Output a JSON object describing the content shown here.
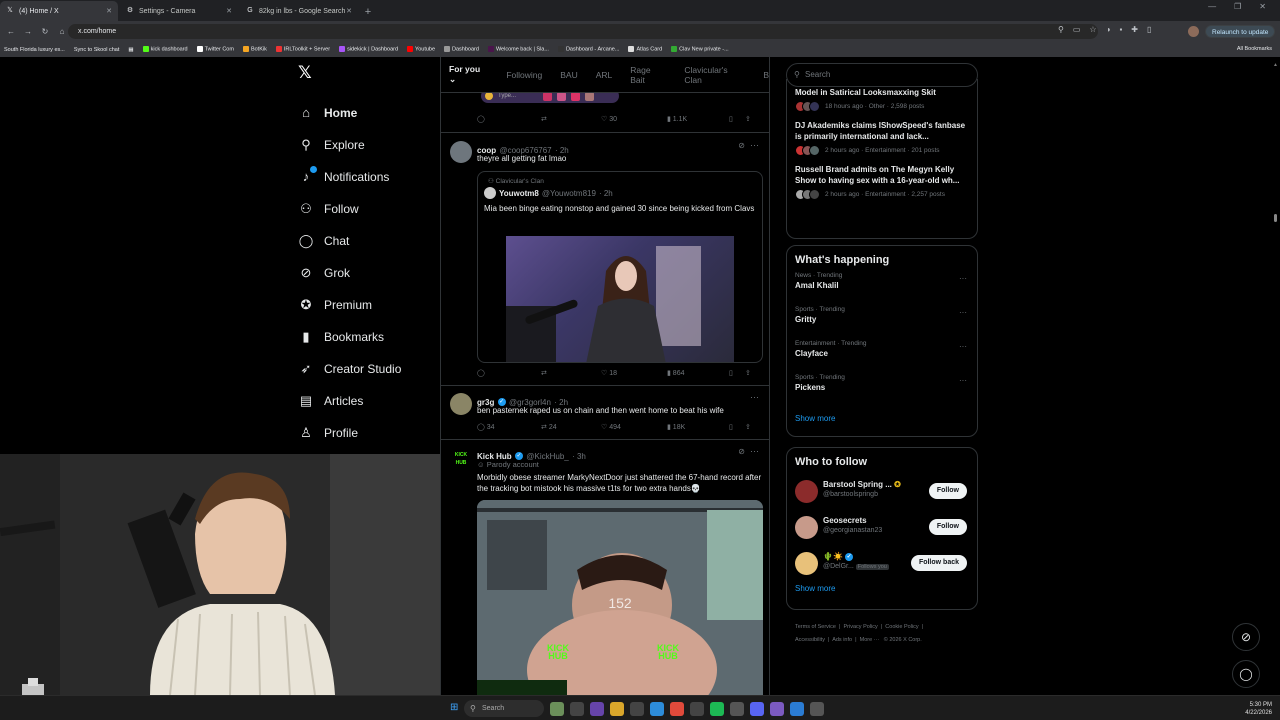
{
  "browser": {
    "tabs": [
      {
        "icon": "x-logo-icon",
        "title": "(4) Home / X",
        "active": true
      },
      {
        "icon": "gear-icon",
        "title": "Settings - Camera",
        "active": false
      },
      {
        "icon": "google-icon",
        "title": "82kg in lbs - Google Search",
        "active": false
      }
    ],
    "url": "x.com/home",
    "relaunch_label": "Relaunch to update",
    "bookmarks": [
      "South Florida luxury es...",
      "Sync to Skool chat",
      "kick dashboard",
      "Twitter Com",
      "BotKik",
      "IRLToolkit + Server",
      "sidekick | Dashboard",
      "Youtube",
      "Dashboard",
      "Welcome back | Sla...",
      "Dashboard - Arcane...",
      "Atlas Card",
      "Clav New private -..."
    ],
    "all_bookmarks": "All Bookmarks"
  },
  "sidebar": {
    "items": [
      {
        "icon": "home-icon",
        "glyph": "⌂",
        "label": "Home"
      },
      {
        "icon": "search-icon",
        "glyph": "⚲",
        "label": "Explore"
      },
      {
        "icon": "bell-icon",
        "glyph": "♪",
        "label": "Notifications"
      },
      {
        "icon": "follow-icon",
        "glyph": "⚇",
        "label": "Follow"
      },
      {
        "icon": "chat-icon",
        "glyph": "◯",
        "label": "Chat"
      },
      {
        "icon": "grok-icon",
        "glyph": "⊘",
        "label": "Grok"
      },
      {
        "icon": "premium-icon",
        "glyph": "✪",
        "label": "Premium"
      },
      {
        "icon": "bookmark-icon",
        "glyph": "▮",
        "label": "Bookmarks"
      },
      {
        "icon": "rocket-icon",
        "glyph": "➶",
        "label": "Creator Studio"
      },
      {
        "icon": "article-icon",
        "glyph": "▤",
        "label": "Articles"
      },
      {
        "icon": "profile-icon",
        "glyph": "♙",
        "label": "Profile"
      }
    ]
  },
  "timeline": {
    "tabs": [
      "For you",
      "Following",
      "BAU",
      "ARL",
      "Rage Bait",
      "Clavicular's Clan",
      "B"
    ],
    "top_post": {
      "type_pill": "Type...",
      "likes": "30",
      "views": "1.1K"
    },
    "post1": {
      "name": "coop",
      "handle": "@coop676767",
      "time": "· 2h",
      "text": "theyre all getting fat lmao",
      "quote": {
        "community": "Clavicular's Clan",
        "name": "Youwotm8",
        "handle": "@Youwotm819",
        "time": "· 2h",
        "text": "Mia been binge eating nonstop and gained 30 since being kicked from Clavs"
      },
      "likes": "18",
      "views": "864"
    },
    "post2": {
      "name": "gr3g",
      "handle": "@gr3gorl4n",
      "time": "· 2h",
      "text": "ben pasternek raped us on chain and then went home to beat his wife",
      "replies": "34",
      "reposts": "24",
      "likes": "494",
      "views": "18K"
    },
    "post3": {
      "name": "Kick Hub",
      "handle": "@KickHub_",
      "time": "· 3h",
      "label": "Parody account",
      "text": "Morbidly obese streamer MarkyNextDoor just shattered the 67-hand record after the tracking bot mistook his massive t1ts for two extra hands💀",
      "video_counter": "152",
      "watermark": "KICK HUB",
      "avatar_text": "KICK HUB"
    }
  },
  "right": {
    "search_placeholder": "Search",
    "news": [
      {
        "title": "Model in Satirical Looksmaxxing Skit",
        "meta": "18 hours ago · Other · 2,598 posts"
      },
      {
        "title": "DJ Akademiks claims IShowSpeed's fanbase is primarily international and lack...",
        "meta": "2 hours ago · Entertainment · 201 posts"
      },
      {
        "title": "Russell Brand admits on The Megyn Kelly Show to having sex with a 16-year-old wh...",
        "meta": "2 hours ago · Entertainment · 2,257 posts"
      }
    ],
    "happening_title": "What's happening",
    "trends": [
      {
        "category": "News · Trending",
        "name": "Amal Khalil"
      },
      {
        "category": "Sports · Trending",
        "name": "Gritty"
      },
      {
        "category": "Entertainment · Trending",
        "name": "Clayface"
      },
      {
        "category": "Sports · Trending",
        "name": "Pickens"
      }
    ],
    "show_more": "Show more",
    "wtf_title": "Who to follow",
    "wtf": [
      {
        "name": "Barstool Spring ...",
        "handle": "@barstoolspringb",
        "button": "Follow",
        "follows_you": ""
      },
      {
        "name": "Geosecrets",
        "handle": "@georgianastan23",
        "button": "Follow",
        "follows_you": ""
      },
      {
        "name": "🌵☀️",
        "handle": "@DelGr...",
        "button": "Follow back",
        "follows_you": "Follows you"
      }
    ],
    "footer": {
      "links": [
        "Terms of Service",
        "Privacy Policy",
        "Cookie Policy",
        "Accessibility",
        "Ads info",
        "More ···"
      ],
      "copyright": "© 2026 X Corp."
    }
  },
  "taskbar": {
    "search_placeholder": "Search",
    "time": "5:30 PM",
    "date": "4/22/2026"
  },
  "colors": {
    "accent": "#1d9bf0",
    "background": "#000000",
    "border": "#2f3336"
  }
}
